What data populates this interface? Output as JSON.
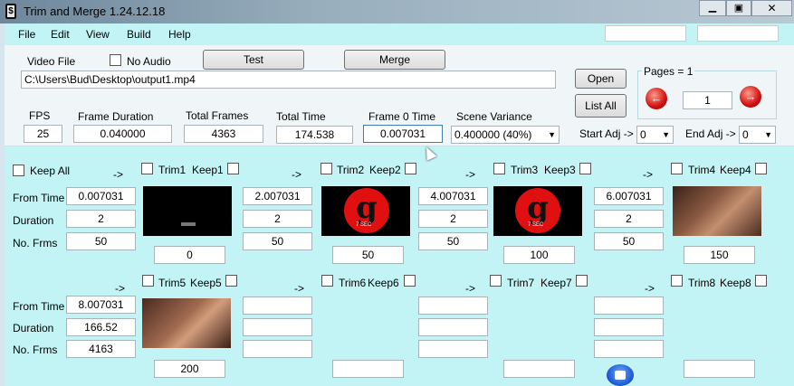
{
  "window": {
    "title": "Trim and Merge 1.24.12.18"
  },
  "menu": [
    "File",
    "Edit",
    "View",
    "Build",
    "Help"
  ],
  "video": {
    "label": "Video File",
    "path": "C:\\Users\\Bud\\Desktop\\output1.mp4",
    "no_audio": "No Audio",
    "test": "Test",
    "merge": "Merge"
  },
  "buttons": {
    "open": "Open",
    "list_all": "List All"
  },
  "pages": {
    "label": "Pages = 1",
    "value": "1"
  },
  "stats": {
    "fps_label": "FPS",
    "fps": "25",
    "frame_duration_label": "Frame Duration",
    "frame_duration": "0.040000",
    "total_frames_label": "Total Frames",
    "total_frames": "4363",
    "total_time_label": "Total Time",
    "total_time": "174.538",
    "frame0_label": "Frame 0 Time",
    "frame0": "0.007031",
    "scene_label": "Scene Variance",
    "scene": "0.400000  (40%)"
  },
  "adj": {
    "start_label": "Start Adj ->",
    "start": "0",
    "end_label": "End Adj ->",
    "end": "0"
  },
  "row_labels": {
    "from": "From Time",
    "duration": "Duration",
    "frames": "No. Frms",
    "keep_all": "Keep All",
    "arrow": "->"
  },
  "trims": {
    "t1": {
      "trim": "Trim1",
      "keep": "Keep1",
      "frame": "0"
    },
    "t2": {
      "trim": "Trim2",
      "keep": "Keep2",
      "frame": "50",
      "from": "2.007031",
      "dur": "2",
      "frms": "50"
    },
    "t3": {
      "trim": "Trim3",
      "keep": "Keep3",
      "frame": "100",
      "from": "4.007031",
      "dur": "2",
      "frms": "50"
    },
    "t4": {
      "trim": "Trim4",
      "keep": "Keep4",
      "frame": "150",
      "from": "6.007031",
      "dur": "2",
      "frms": "50"
    },
    "t5": {
      "trim": "Trim5",
      "keep": "Keep5",
      "frame": "200"
    },
    "t6": {
      "trim": "Trim6",
      "keep": "Keep6"
    },
    "t7": {
      "trim": "Trim7",
      "keep": "Keep7"
    },
    "t8": {
      "trim": "Trim8",
      "keep": "Keep8"
    }
  },
  "seg1": {
    "from": "0.007031",
    "dur": "2",
    "frms": "50"
  },
  "seg2": {
    "from": "8.007031",
    "dur": "166.52",
    "frms": "4163"
  },
  "thumb_text": {
    "t2": "7 SEC",
    "t3": "7 SEC"
  }
}
